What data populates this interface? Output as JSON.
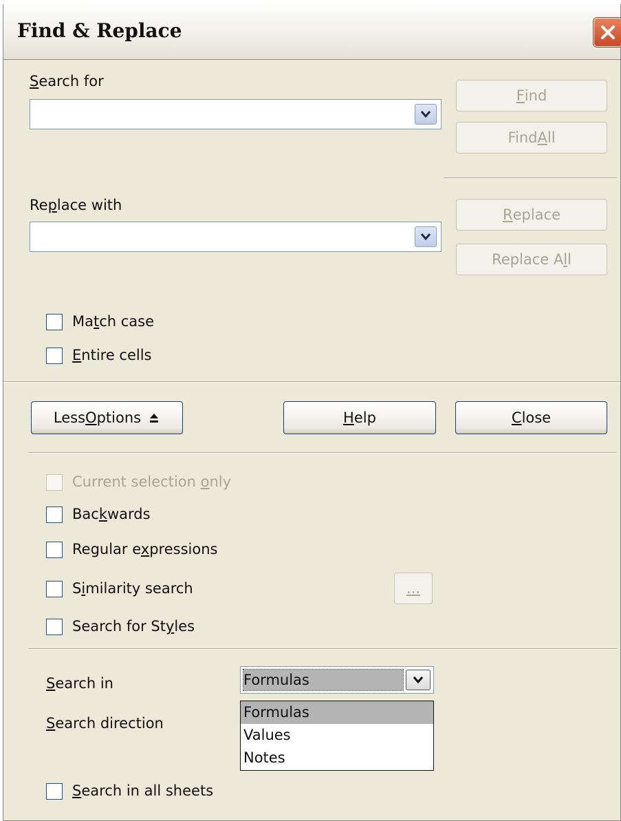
{
  "window": {
    "title": "Find & Replace"
  },
  "search": {
    "label_pre": "",
    "label_key": "S",
    "label_post": "earch for",
    "value": ""
  },
  "replace": {
    "label_pre": "Re",
    "label_key": "p",
    "label_post": "lace with",
    "value": ""
  },
  "buttons": {
    "find": {
      "pre": "",
      "key": "F",
      "post": "ind",
      "enabled": false
    },
    "find_all": {
      "pre": "Find ",
      "key": "A",
      "post": "ll",
      "enabled": false
    },
    "replace": {
      "pre": "",
      "key": "R",
      "post": "eplace",
      "enabled": false
    },
    "replace_all": {
      "pre": "Replace A",
      "key": "l",
      "post": "l",
      "enabled": false
    },
    "less_options": {
      "pre": "Less ",
      "key": "O",
      "post": "ptions"
    },
    "help": {
      "pre": "",
      "key": "H",
      "post": "elp"
    },
    "close": {
      "pre": "",
      "key": "C",
      "post": "lose"
    },
    "similarity_more": {
      "label": "..."
    }
  },
  "options": {
    "match_case": {
      "pre": "Ma",
      "key": "t",
      "post": "ch case",
      "checked": false
    },
    "entire_cells": {
      "pre": "",
      "key": "E",
      "post": "ntire cells",
      "checked": false
    },
    "current_selection": {
      "pre": "Current selection ",
      "key": "o",
      "post": "nly",
      "checked": false,
      "enabled": false
    },
    "backwards": {
      "pre": "Bac",
      "key": "k",
      "post": "wards",
      "checked": false
    },
    "regex": {
      "pre": "Regular e",
      "key": "x",
      "post": "pressions",
      "checked": false
    },
    "similarity": {
      "pre": "S",
      "key": "i",
      "post": "milarity search",
      "checked": false
    },
    "styles": {
      "pre": "Search for St",
      "key": "y",
      "post": "les",
      "checked": false
    },
    "all_sheets": {
      "pre": "",
      "key": "S",
      "post": "earch in all sheets",
      "checked": false
    }
  },
  "search_in": {
    "label_pre": "",
    "label_key": "S",
    "label_post": "earch in",
    "selected": "Formulas",
    "list_options": [
      "Formulas",
      "Values",
      "Notes"
    ],
    "highlighted_index": 0
  },
  "search_direction": {
    "label_pre": "",
    "label_key": "S",
    "label_post": "earch direction"
  }
}
